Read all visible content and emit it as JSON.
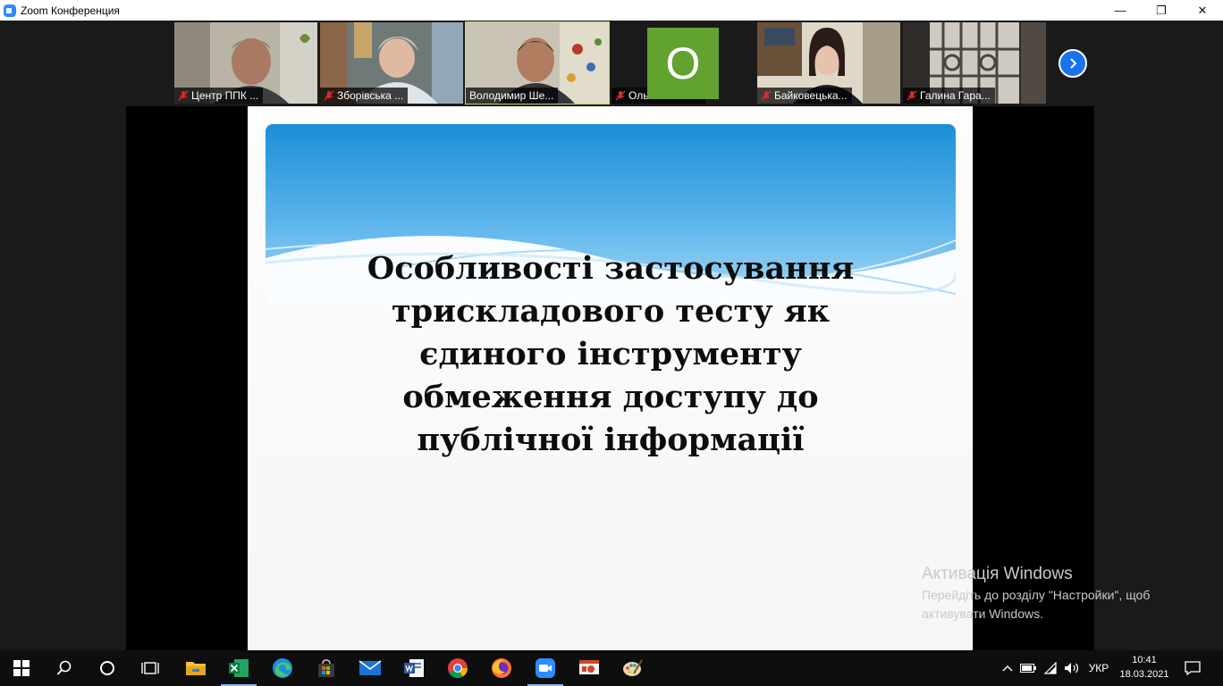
{
  "window": {
    "title": "Zoom Конференция",
    "controls": {
      "minimize": "—",
      "restore": "❐",
      "close": "✕"
    }
  },
  "participants": [
    {
      "name": "Центр ППК ...",
      "muted": true
    },
    {
      "name": "Зборівська ...",
      "muted": true
    },
    {
      "name": "Володимир Ше...",
      "muted": false,
      "active_speaker": true
    },
    {
      "name": "Ольга Забло...",
      "muted": true,
      "avatar_letter": "O",
      "avatar_color": "#62a22f"
    },
    {
      "name": "Байковецька...",
      "muted": true
    },
    {
      "name": "Галина Гара...",
      "muted": true
    }
  ],
  "gallery_next_icon": "chevron-right-icon",
  "slide": {
    "title_lines": [
      "Особливості застосування",
      "трискладового тесту як",
      "єдиного інструменту",
      "обмеження доступу до",
      "публічної інформації"
    ]
  },
  "activation": {
    "title": "Активація Windows",
    "line1": "Перейдіть до розділу \"Настройки\", щоб",
    "line2": "активувати Windows."
  },
  "taskbar": {
    "apps": [
      "start-icon",
      "search-icon",
      "cortana-icon",
      "task-view-icon",
      "file-explorer-icon",
      "excel-icon",
      "edge-icon",
      "store-icon",
      "mail-icon",
      "word-icon",
      "chrome-icon",
      "firefox-icon",
      "zoom-icon",
      "powerpoint-icon",
      "paint-icon"
    ],
    "language": "УКР",
    "time": "10:41",
    "date": "18.03.2021"
  },
  "colors": {
    "accent_blue": "#1a73e8",
    "muted_red": "#e02828",
    "active_speaker_border": "#c6d95a"
  }
}
